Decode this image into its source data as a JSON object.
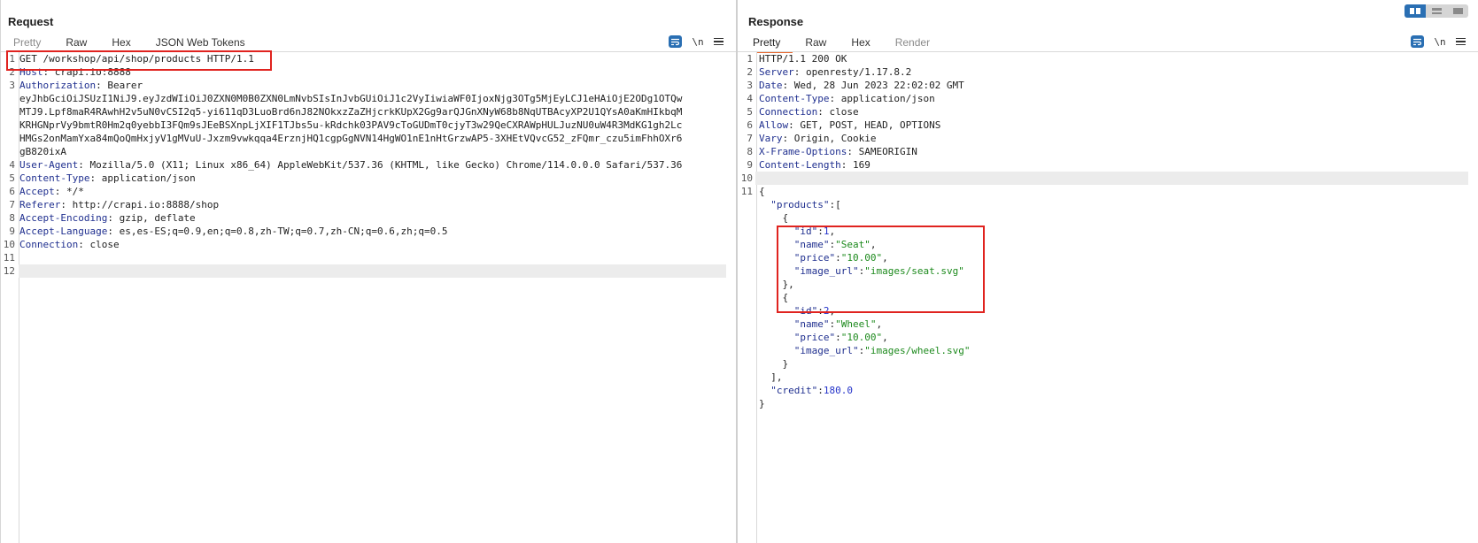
{
  "request": {
    "title": "Request",
    "tabs": [
      {
        "label": "Pretty",
        "state": "dim"
      },
      {
        "label": "Raw",
        "state": "normal"
      },
      {
        "label": "Hex",
        "state": "normal"
      },
      {
        "label": "JSON Web Tokens",
        "state": "normal"
      }
    ],
    "tools": {
      "wrap_icon": "wrap-icon",
      "newline_label": "\\n",
      "menu_icon": "menu-icon"
    },
    "lines": [
      {
        "n": "1",
        "parts": [
          {
            "t": "GET /workshop/api/shop/products HTTP/1.1",
            "c": ""
          }
        ]
      },
      {
        "n": "2",
        "parts": [
          {
            "t": "Host",
            "c": "hk"
          },
          {
            "t": ": crapi.io:8888",
            "c": ""
          }
        ]
      },
      {
        "n": "3",
        "parts": [
          {
            "t": "Authorization",
            "c": "hk"
          },
          {
            "t": ": Bearer",
            "c": ""
          }
        ]
      },
      {
        "n": "",
        "parts": [
          {
            "t": "eyJhbGciOiJSUzI1NiJ9.eyJzdWIiOiJ0ZXN0M0B0ZXN0LmNvbSIsInJvbGUiOiJ1c2VyIiwiaWF0IjoxNjg3OTg5MjEyLCJ1eHAiOjE2ODg1OTQw",
            "c": ""
          }
        ]
      },
      {
        "n": "",
        "parts": [
          {
            "t": "MTJ9.Lpf8maR4RAwhH2v5uN0vCSI2q5-yi611qD3LuoBrd6nJ82NOkxzZaZHjcrkKUpX2Gg9arQJGnXNyW68b8NqUTBAcyXP2U1QYsA0aKmHIkbqM",
            "c": ""
          }
        ]
      },
      {
        "n": "",
        "parts": [
          {
            "t": "KRHGNprVy9bmtR0Hm2q0yebbI3FQm9sJEeBSXnpLjXIF1TJbs5u-kRdchk03PAV9cToGUDmT0cjyT3w29QeCXRAWpHULJuzNU0uW4R3MdKG1gh2Lc",
            "c": ""
          }
        ]
      },
      {
        "n": "",
        "parts": [
          {
            "t": "HMGs2onMamYxa84mQoQmHxjyV1gMVuU-Jxzm9vwkqqa4ErznjHQ1cgpGgNVN14HgWO1nE1nHtGrzwAP5-3XHEtVQvcG52_zFQmr_czu5imFhhOXr6",
            "c": ""
          }
        ]
      },
      {
        "n": "",
        "parts": [
          {
            "t": "gB820ixA",
            "c": ""
          }
        ]
      },
      {
        "n": "4",
        "parts": [
          {
            "t": "User-Agent",
            "c": "hk"
          },
          {
            "t": ": Mozilla/5.0 (X11; Linux x86_64) AppleWebKit/537.36 (KHTML, like Gecko) Chrome/114.0.0.0 Safari/537.36",
            "c": ""
          }
        ]
      },
      {
        "n": "5",
        "parts": [
          {
            "t": "Content-Type",
            "c": "hk"
          },
          {
            "t": ": application/json",
            "c": ""
          }
        ]
      },
      {
        "n": "6",
        "parts": [
          {
            "t": "Accept",
            "c": "hk"
          },
          {
            "t": ": */*",
            "c": ""
          }
        ]
      },
      {
        "n": "7",
        "parts": [
          {
            "t": "Referer",
            "c": "hk"
          },
          {
            "t": ": http://crapi.io:8888/shop",
            "c": ""
          }
        ]
      },
      {
        "n": "8",
        "parts": [
          {
            "t": "Accept-Encoding",
            "c": "hk"
          },
          {
            "t": ": gzip, deflate",
            "c": ""
          }
        ]
      },
      {
        "n": "9",
        "parts": [
          {
            "t": "Accept-Language",
            "c": "hk"
          },
          {
            "t": ": es,es-ES;q=0.9,en;q=0.8,zh-TW;q=0.7,zh-CN;q=0.6,zh;q=0.5",
            "c": ""
          }
        ]
      },
      {
        "n": "10",
        "parts": [
          {
            "t": "Connection",
            "c": "hk"
          },
          {
            "t": ": close",
            "c": ""
          }
        ]
      },
      {
        "n": "11",
        "parts": []
      },
      {
        "n": "12",
        "parts": []
      }
    ]
  },
  "response": {
    "title": "Response",
    "tabs": [
      {
        "label": "Pretty",
        "state": "active"
      },
      {
        "label": "Raw",
        "state": "normal"
      },
      {
        "label": "Hex",
        "state": "normal"
      },
      {
        "label": "Render",
        "state": "dim"
      }
    ],
    "tools": {
      "wrap_icon": "wrap-icon",
      "newline_label": "\\n",
      "menu_icon": "menu-icon"
    },
    "lines": [
      {
        "n": "1",
        "parts": [
          {
            "t": "HTTP/1.1 200 OK",
            "c": ""
          }
        ]
      },
      {
        "n": "2",
        "parts": [
          {
            "t": "Server",
            "c": "hk"
          },
          {
            "t": ": openresty/1.17.8.2",
            "c": ""
          }
        ]
      },
      {
        "n": "3",
        "parts": [
          {
            "t": "Date",
            "c": "hk"
          },
          {
            "t": ": Wed, 28 Jun 2023 22:02:02 GMT",
            "c": ""
          }
        ]
      },
      {
        "n": "4",
        "parts": [
          {
            "t": "Content-Type",
            "c": "hk"
          },
          {
            "t": ": application/json",
            "c": ""
          }
        ]
      },
      {
        "n": "5",
        "parts": [
          {
            "t": "Connection",
            "c": "hk"
          },
          {
            "t": ": close",
            "c": ""
          }
        ]
      },
      {
        "n": "6",
        "parts": [
          {
            "t": "Allow",
            "c": "hk"
          },
          {
            "t": ": GET, POST, HEAD, OPTIONS",
            "c": ""
          }
        ]
      },
      {
        "n": "7",
        "parts": [
          {
            "t": "Vary",
            "c": "hk"
          },
          {
            "t": ": Origin, Cookie",
            "c": ""
          }
        ]
      },
      {
        "n": "8",
        "parts": [
          {
            "t": "X-Frame-Options",
            "c": "hk"
          },
          {
            "t": ": SAMEORIGIN",
            "c": ""
          }
        ]
      },
      {
        "n": "9",
        "parts": [
          {
            "t": "Content-Length",
            "c": "hk"
          },
          {
            "t": ": 169",
            "c": ""
          }
        ]
      },
      {
        "n": "10",
        "parts": []
      },
      {
        "n": "11",
        "parts": [
          {
            "t": "{",
            "c": ""
          }
        ]
      },
      {
        "n": "",
        "parts": [
          {
            "t": "  ",
            "c": ""
          },
          {
            "t": "\"products\"",
            "c": "jk"
          },
          {
            "t": ":[",
            "c": ""
          }
        ]
      },
      {
        "n": "",
        "parts": [
          {
            "t": "    {",
            "c": ""
          }
        ]
      },
      {
        "n": "",
        "parts": [
          {
            "t": "      ",
            "c": ""
          },
          {
            "t": "\"id\"",
            "c": "jk"
          },
          {
            "t": ":",
            "c": ""
          },
          {
            "t": "1",
            "c": "jn"
          },
          {
            "t": ",",
            "c": ""
          }
        ]
      },
      {
        "n": "",
        "parts": [
          {
            "t": "      ",
            "c": ""
          },
          {
            "t": "\"name\"",
            "c": "jk"
          },
          {
            "t": ":",
            "c": ""
          },
          {
            "t": "\"Seat\"",
            "c": "js"
          },
          {
            "t": ",",
            "c": ""
          }
        ]
      },
      {
        "n": "",
        "parts": [
          {
            "t": "      ",
            "c": ""
          },
          {
            "t": "\"price\"",
            "c": "jk"
          },
          {
            "t": ":",
            "c": ""
          },
          {
            "t": "\"10.00\"",
            "c": "js"
          },
          {
            "t": ",",
            "c": ""
          }
        ]
      },
      {
        "n": "",
        "parts": [
          {
            "t": "      ",
            "c": ""
          },
          {
            "t": "\"image_url\"",
            "c": "jk"
          },
          {
            "t": ":",
            "c": ""
          },
          {
            "t": "\"images/seat.svg\"",
            "c": "js"
          }
        ]
      },
      {
        "n": "",
        "parts": [
          {
            "t": "    },",
            "c": ""
          }
        ]
      },
      {
        "n": "",
        "parts": [
          {
            "t": "    {",
            "c": ""
          }
        ]
      },
      {
        "n": "",
        "parts": [
          {
            "t": "      ",
            "c": ""
          },
          {
            "t": "\"id\"",
            "c": "jk"
          },
          {
            "t": ":",
            "c": ""
          },
          {
            "t": "2",
            "c": "jn"
          },
          {
            "t": ",",
            "c": ""
          }
        ]
      },
      {
        "n": "",
        "parts": [
          {
            "t": "      ",
            "c": ""
          },
          {
            "t": "\"name\"",
            "c": "jk"
          },
          {
            "t": ":",
            "c": ""
          },
          {
            "t": "\"Wheel\"",
            "c": "js"
          },
          {
            "t": ",",
            "c": ""
          }
        ]
      },
      {
        "n": "",
        "parts": [
          {
            "t": "      ",
            "c": ""
          },
          {
            "t": "\"price\"",
            "c": "jk"
          },
          {
            "t": ":",
            "c": ""
          },
          {
            "t": "\"10.00\"",
            "c": "js"
          },
          {
            "t": ",",
            "c": ""
          }
        ]
      },
      {
        "n": "",
        "parts": [
          {
            "t": "      ",
            "c": ""
          },
          {
            "t": "\"image_url\"",
            "c": "jk"
          },
          {
            "t": ":",
            "c": ""
          },
          {
            "t": "\"images/wheel.svg\"",
            "c": "js"
          }
        ]
      },
      {
        "n": "",
        "parts": [
          {
            "t": "    }",
            "c": ""
          }
        ]
      },
      {
        "n": "",
        "parts": [
          {
            "t": "  ],",
            "c": ""
          }
        ]
      },
      {
        "n": "",
        "parts": [
          {
            "t": "  ",
            "c": ""
          },
          {
            "t": "\"credit\"",
            "c": "jk"
          },
          {
            "t": ":",
            "c": ""
          },
          {
            "t": "180.0",
            "c": "jn"
          }
        ]
      },
      {
        "n": "",
        "parts": [
          {
            "t": "}",
            "c": ""
          }
        ]
      }
    ]
  },
  "layout_toggle": [
    {
      "icon": "side-by-side-layout-icon",
      "active": true
    },
    {
      "icon": "stacked-layout-icon",
      "active": false
    },
    {
      "icon": "single-pane-layout-icon",
      "active": false
    }
  ],
  "colors": {
    "accent": "#2a6fb3",
    "active_tab_underline": "#e8662c",
    "highlight_box": "#e0231f",
    "header_key": "#1f2f8f",
    "json_string": "#1d8a1d",
    "json_number": "#2433c9"
  }
}
